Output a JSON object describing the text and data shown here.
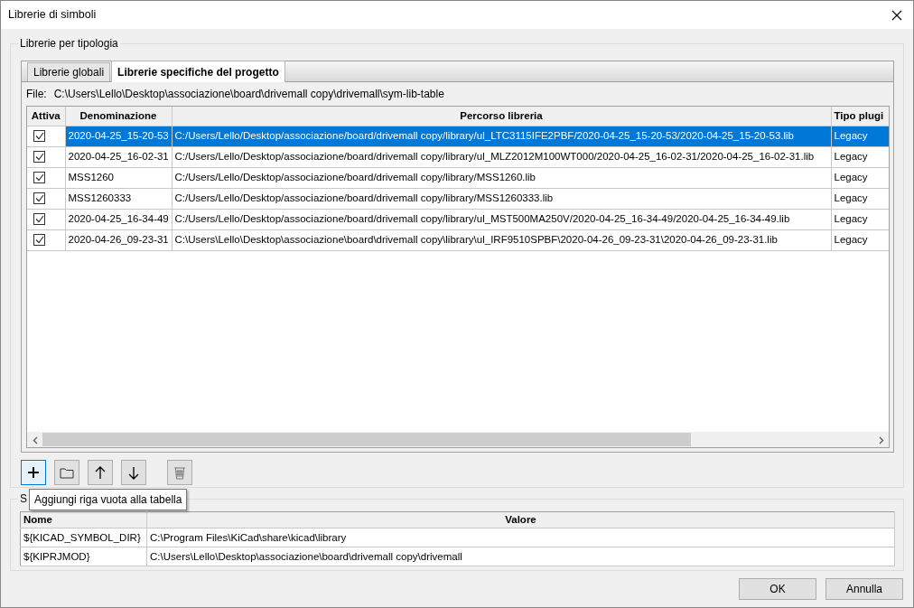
{
  "window": {
    "title": "Librerie di simboli"
  },
  "group": {
    "title": "Librerie per tipologia"
  },
  "tabs": [
    {
      "label": "Librerie globali",
      "selected": false
    },
    {
      "label": "Librerie specifiche del progetto",
      "selected": true
    }
  ],
  "file": {
    "label": "File:",
    "path": "C:\\Users\\Lello\\Desktop\\associazione\\board\\drivemall copy\\drivemall\\sym-lib-table"
  },
  "table": {
    "columns": [
      "Attiva",
      "Denominazione",
      "Percorso libreria",
      "Tipo plugi"
    ],
    "rows": [
      {
        "checked": true,
        "selected": true,
        "name": "2020-04-25_15-20-53",
        "path": "C:/Users/Lello/Desktop/associazione/board/drivemall copy/library/ul_LTC3115IFE2PBF/2020-04-25_15-20-53/2020-04-25_15-20-53.lib",
        "plugin": "Legacy"
      },
      {
        "checked": true,
        "selected": false,
        "name": "2020-04-25_16-02-31",
        "path": "C:/Users/Lello/Desktop/associazione/board/drivemall copy/library/ul_MLZ2012M100WT000/2020-04-25_16-02-31/2020-04-25_16-02-31.lib",
        "plugin": "Legacy"
      },
      {
        "checked": true,
        "selected": false,
        "name": "MSS1260",
        "path": "C:/Users/Lello/Desktop/associazione/board/drivemall copy/library/MSS1260.lib",
        "plugin": "Legacy"
      },
      {
        "checked": true,
        "selected": false,
        "name": "MSS1260333",
        "path": "C:/Users/Lello/Desktop/associazione/board/drivemall copy/library/MSS1260333.lib",
        "plugin": "Legacy"
      },
      {
        "checked": true,
        "selected": false,
        "name": "2020-04-25_16-34-49",
        "path": "C:/Users/Lello/Desktop/associazione/board/drivemall copy/library/ul_MST500MA250V/2020-04-25_16-34-49/2020-04-25_16-34-49.lib",
        "plugin": "Legacy"
      },
      {
        "checked": true,
        "selected": false,
        "name": "2020-04-26_09-23-31",
        "path": "C:\\Users\\Lello\\Desktop\\associazione\\board\\drivemall copy\\library\\ul_IRF9510SPBF\\2020-04-26_09-23-31\\2020-04-26_09-23-31.lib",
        "plugin": "Legacy"
      }
    ]
  },
  "toolbar": [
    {
      "kind": "add",
      "focused": true
    },
    {
      "kind": "folder",
      "focused": false
    },
    {
      "kind": "up",
      "focused": false
    },
    {
      "kind": "down",
      "focused": false
    },
    {
      "kind": "delete",
      "focused": false
    }
  ],
  "tooltip": "Aggiungi riga vuota alla tabella",
  "vars_group": {
    "title": "S"
  },
  "vars_table": {
    "columns": [
      "Nome",
      "Valore"
    ],
    "rows": [
      {
        "name": "${KICAD_SYMBOL_DIR}",
        "value": "C:\\Program Files\\KiCad\\share\\kicad\\library"
      },
      {
        "name": "${KIPRJMOD}",
        "value": "C:\\Users\\Lello\\Desktop\\associazione\\board\\drivemall copy\\drivemall"
      }
    ]
  },
  "buttons": [
    "OK",
    "Annulla"
  ]
}
